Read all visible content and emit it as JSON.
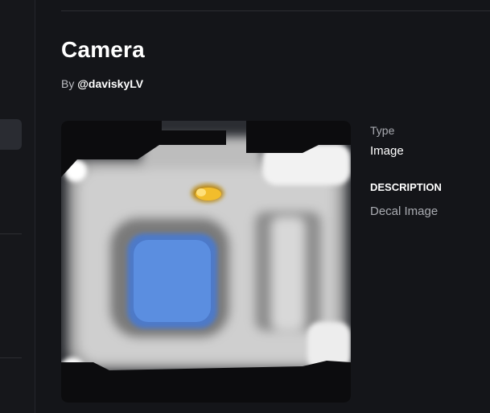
{
  "item": {
    "title": "Camera",
    "byline_prefix": "By ",
    "creator": "@daviskyLV",
    "thumbnail_icon": "camera-icon"
  },
  "details": {
    "type_label": "Type",
    "type_value": "Image",
    "description_heading": "DESCRIPTION",
    "description_text": "Decal Image"
  },
  "colors": {
    "background": "#141519",
    "lens": "#5b8ee0",
    "flash": "#f2bd2c",
    "body": "#c7c7c7"
  }
}
